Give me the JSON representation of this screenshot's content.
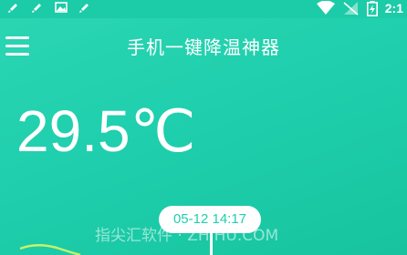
{
  "status_bar": {
    "time": "2:1",
    "left_icons": [
      "brush-icon",
      "brush-icon",
      "image-icon",
      "brush-icon"
    ],
    "right_icons": [
      "wifi-icon",
      "signal-icon",
      "battery-charging-icon"
    ]
  },
  "app_bar": {
    "menu_icon": "menu-icon",
    "title": "手机一键降温神器"
  },
  "temperature": {
    "value": "29.5℃"
  },
  "chart": {
    "marker_label": "05-12 14:17",
    "watermark": "指尖汇软件 · ZHIHU.COM"
  },
  "colors": {
    "background": "#1fcfad",
    "status_bar": "#1ccba7",
    "curve": "#c4f36a"
  }
}
